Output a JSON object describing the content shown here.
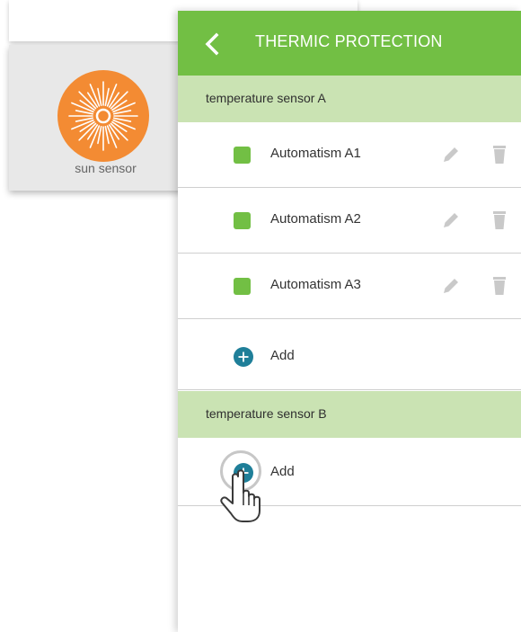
{
  "header": {
    "title": "THERMIC PROTECTION",
    "back_icon": "chevron-left-icon"
  },
  "sensor_card": {
    "label": "sun sensor",
    "icon": "sun-icon",
    "icon_color": "#f38b33"
  },
  "sections": [
    {
      "title": "temperature sensor A",
      "items": [
        {
          "label": "Automatism A1"
        },
        {
          "label": "Automatism A2"
        },
        {
          "label": "Automatism A3"
        }
      ],
      "add_label": "Add"
    },
    {
      "title": "temperature sensor B",
      "items": [],
      "add_label": "Add"
    }
  ],
  "colors": {
    "header": "#72bf44",
    "section": "#cae3b3",
    "swatch": "#72bf44",
    "add_button": "#1f7f99"
  },
  "icons": {
    "edit": "pencil-icon",
    "delete": "trash-icon",
    "add": "plus-circle-icon",
    "pointer": "hand-pointer-icon"
  }
}
